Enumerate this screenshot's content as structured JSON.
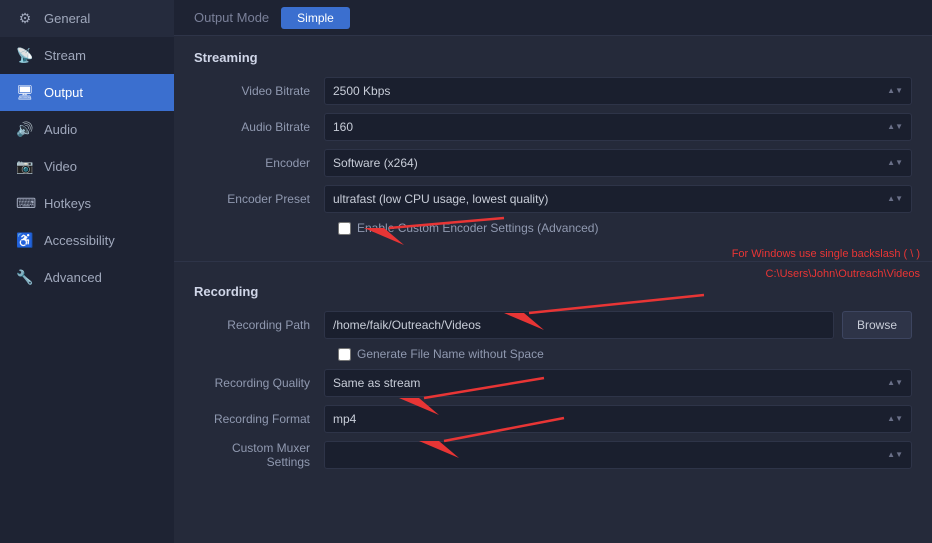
{
  "sidebar": {
    "items": [
      {
        "id": "general",
        "label": "General",
        "icon": "⚙",
        "active": false
      },
      {
        "id": "stream",
        "label": "Stream",
        "icon": "📡",
        "active": false
      },
      {
        "id": "output",
        "label": "Output",
        "icon": "🖥",
        "active": true
      },
      {
        "id": "audio",
        "label": "Audio",
        "icon": "🔊",
        "active": false
      },
      {
        "id": "video",
        "label": "Video",
        "icon": "📷",
        "active": false
      },
      {
        "id": "hotkeys",
        "label": "Hotkeys",
        "icon": "⌨",
        "active": false
      },
      {
        "id": "accessibility",
        "label": "Accessibility",
        "icon": "♿",
        "active": false
      },
      {
        "id": "advanced",
        "label": "Advanced",
        "icon": "🔧",
        "active": false
      }
    ]
  },
  "tabBar": {
    "label": "Output Mode",
    "tab": "Simple"
  },
  "streaming": {
    "sectionTitle": "Streaming",
    "videoBitrateLabel": "Video Bitrate",
    "videoBitrateValue": "2500 Kbps",
    "audioBitrateLabel": "Audio Bitrate",
    "audioBitrateValue": "160",
    "encoderLabel": "Encoder",
    "encoderValue": "Software (x264)",
    "encoderPresetLabel": "Encoder Preset",
    "encoderPresetValue": "ultrafast (low CPU usage, lowest quality)",
    "enableCustomCheckbox": "Enable Custom Encoder Settings (Advanced)"
  },
  "recording": {
    "sectionTitle": "Recording",
    "pathLabel": "Recording Path",
    "pathValue": "/home/faik/Outreach/Videos",
    "browseLabel": "Browse",
    "generateFileNameLabel": "Generate File Name without Space",
    "qualityLabel": "Recording Quality",
    "qualityValue": "Same as stream",
    "formatLabel": "Recording Format",
    "formatValue": "mp4",
    "muxerLabel": "Custom Muxer Settings"
  },
  "annotations": {
    "line1": "For Windows use single backslash ( \\ )",
    "line2": "C:\\Users\\John\\Outreach\\Videos"
  }
}
